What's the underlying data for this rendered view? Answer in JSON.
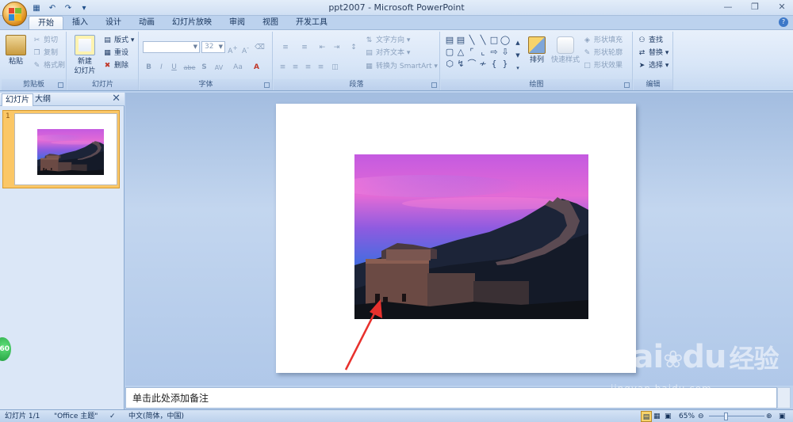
{
  "window": {
    "title": "ppt2007 - Microsoft PowerPoint",
    "qat": [
      "save-icon",
      "undo-icon",
      "redo-icon",
      "customize-icon"
    ]
  },
  "tabs": [
    "开始",
    "插入",
    "设计",
    "动画",
    "幻灯片放映",
    "审阅",
    "视图",
    "开发工具"
  ],
  "active_tab": "开始",
  "ribbon": {
    "clipboard": {
      "label": "剪贴板",
      "paste": "粘贴",
      "cut": "剪切",
      "copy": "复制",
      "format_painter": "格式刷"
    },
    "slides": {
      "label": "幻灯片",
      "new_slide": "新建",
      "new_slide2": "幻灯片",
      "layout": "版式",
      "reset": "重设",
      "delete": "删除"
    },
    "font": {
      "label": "字体",
      "font_size": "32",
      "bold": "B",
      "italic": "I",
      "underline": "U",
      "strike": "abe",
      "shadow": "S",
      "spacing": "AV",
      "case": "Aa"
    },
    "paragraph": {
      "label": "段落",
      "text_direction": "文字方向",
      "align_text": "对齐文本",
      "smartart": "转换为 SmartArt"
    },
    "drawing": {
      "label": "绘图",
      "arrange": "排列",
      "quick_styles": "快速样式",
      "shape_fill": "形状填充",
      "shape_outline": "形状轮廓",
      "shape_effects": "形状效果"
    },
    "editing": {
      "label": "编辑",
      "find": "查找",
      "replace": "替换",
      "select": "选择"
    }
  },
  "left_panel": {
    "tab_slides": "幻灯片",
    "tab_outline": "大纲",
    "slide_number": "1"
  },
  "notes": {
    "placeholder": "单击此处添加备注"
  },
  "statusbar": {
    "slide_info": "幻灯片 1/1",
    "theme": "\"Office 主题\"",
    "language": "中文(简体，中国)",
    "zoom": "65%"
  },
  "badge": {
    "text": "60"
  },
  "watermark": {
    "brand1": "Bai",
    "brand2": "du",
    "brand3": "经验",
    "url": "jingyan.baidu.com"
  },
  "colors": {
    "ribbon": "#d7e5f7",
    "accent_tab": "#fbc766",
    "workspace": "#b0c8e9",
    "arrow": "#e8312d"
  }
}
